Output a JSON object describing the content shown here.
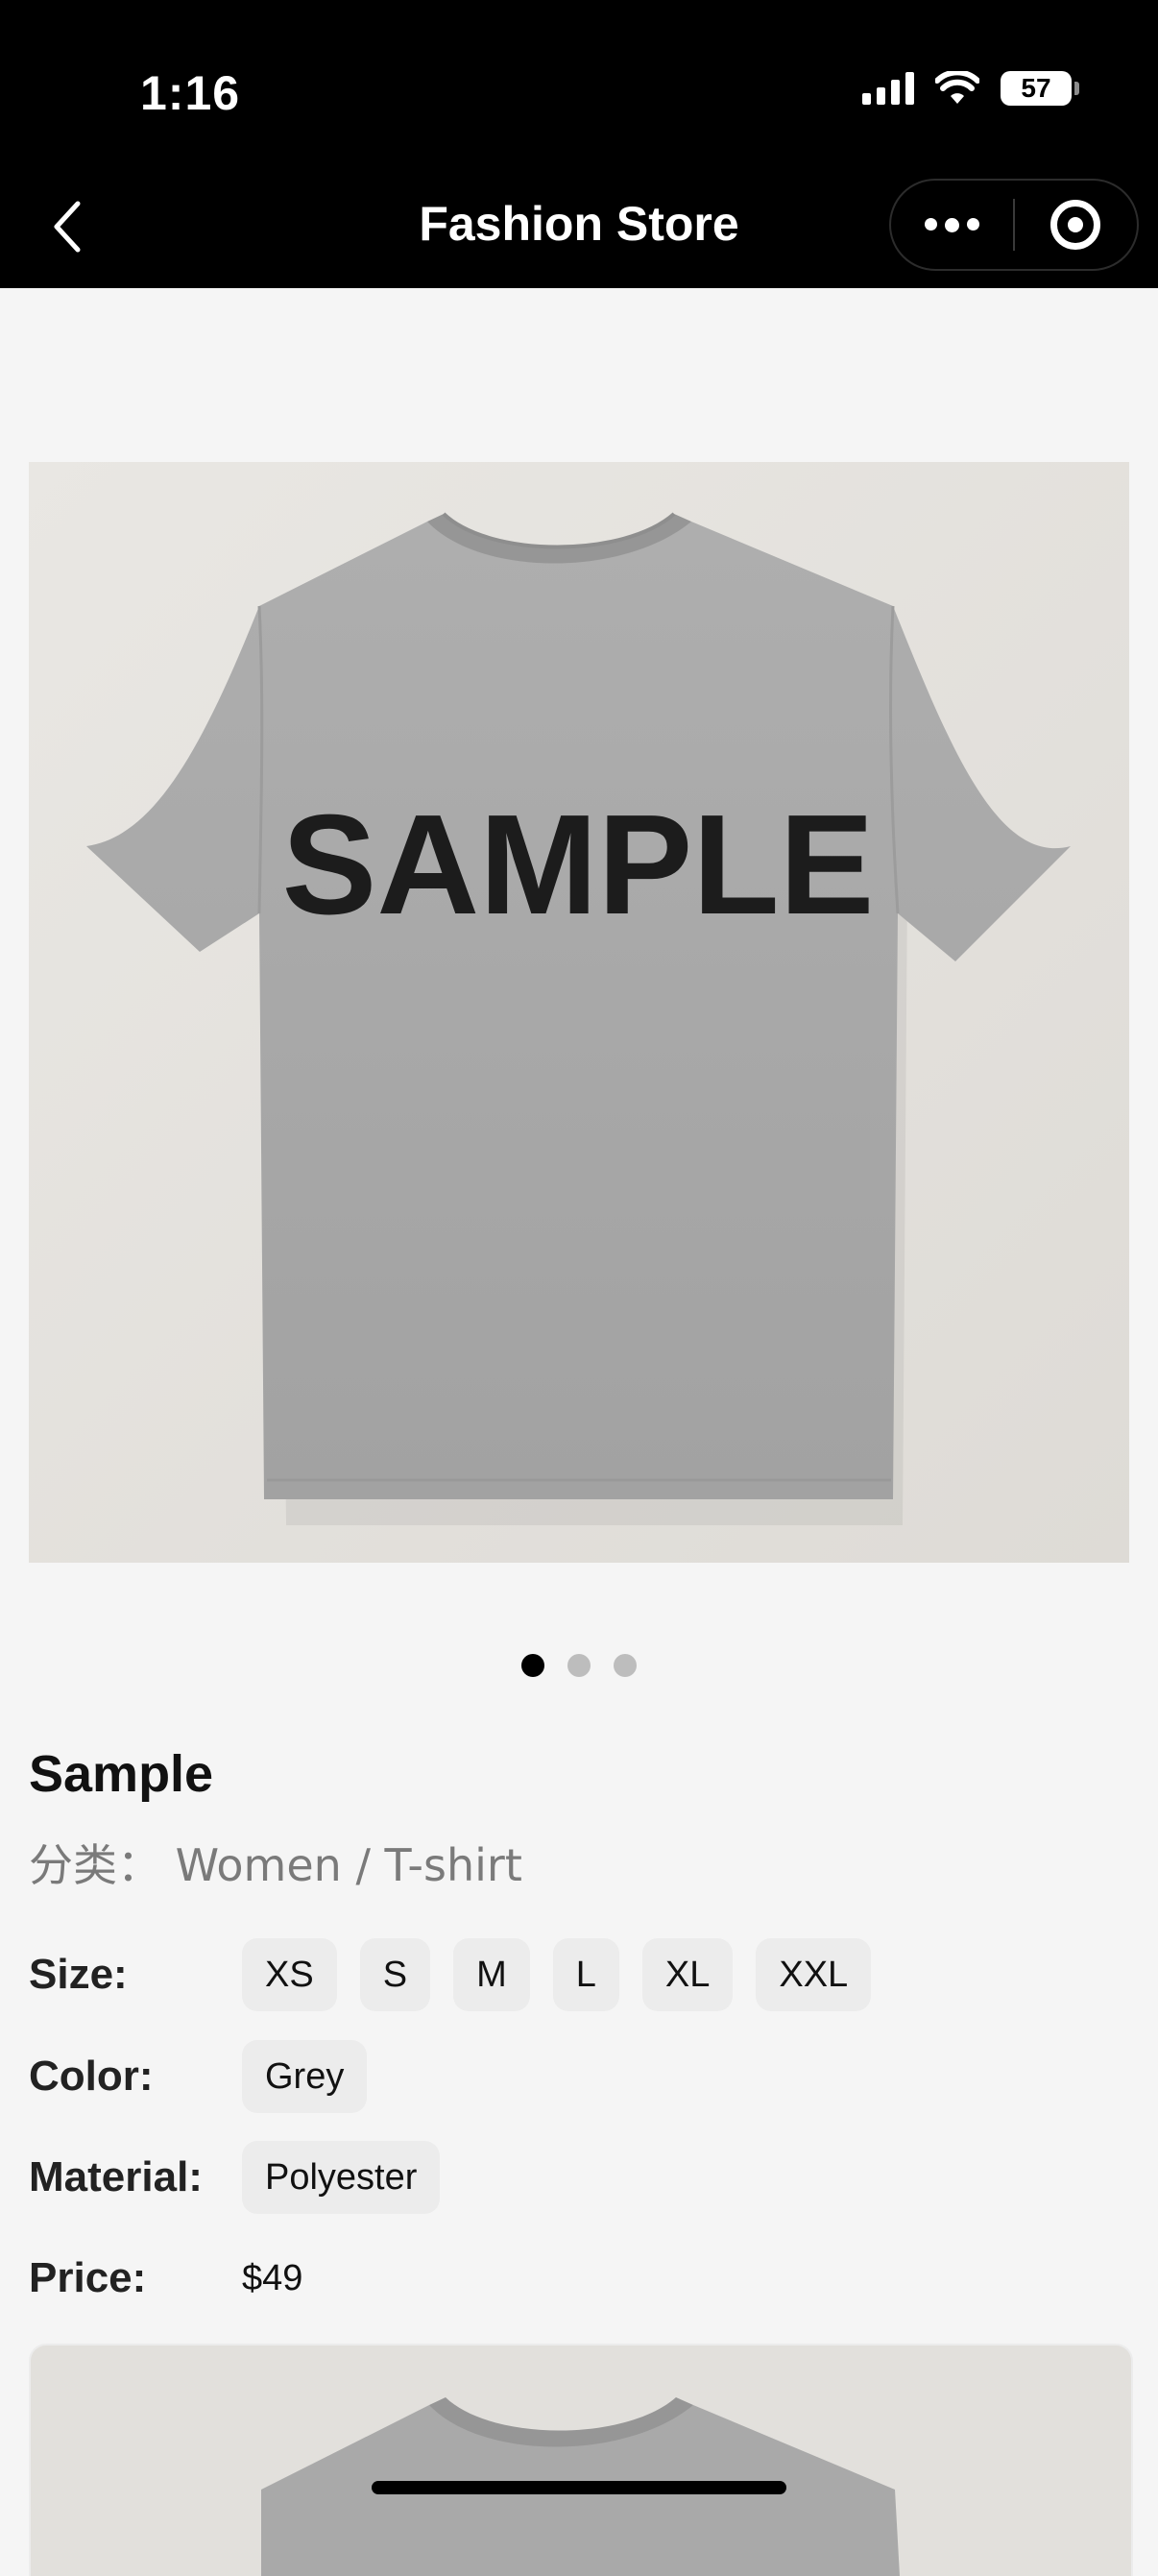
{
  "status_bar": {
    "time": "1:16",
    "battery": "57",
    "icons": [
      "signal-icon",
      "wifi-icon",
      "battery-icon"
    ]
  },
  "nav": {
    "title": "Fashion Store",
    "back_icon": "chevron-left-icon",
    "more_icon": "more-dots-icon",
    "close_icon": "target-circle-icon"
  },
  "product": {
    "image_print_text": "SAMPLE",
    "carousel_count": 3,
    "carousel_active_index": 0,
    "name": "Sample",
    "category": "分类： Women / T-shirt",
    "size_label": "Size:",
    "sizes": [
      "XS",
      "S",
      "M",
      "L",
      "XL",
      "XXL"
    ],
    "color_label": "Color:",
    "colors": [
      "Grey"
    ],
    "material_label": "Material:",
    "materials": [
      "Polyester"
    ],
    "price_label": "Price:",
    "price": "$49"
  },
  "colors": {
    "header_bg": "#000000",
    "page_bg": "#f5f5f5",
    "chip_bg": "#ececec",
    "shirt_grey": "#a8a8a8",
    "dot_active": "#000000",
    "dot_inactive": "#bdbdbd"
  }
}
